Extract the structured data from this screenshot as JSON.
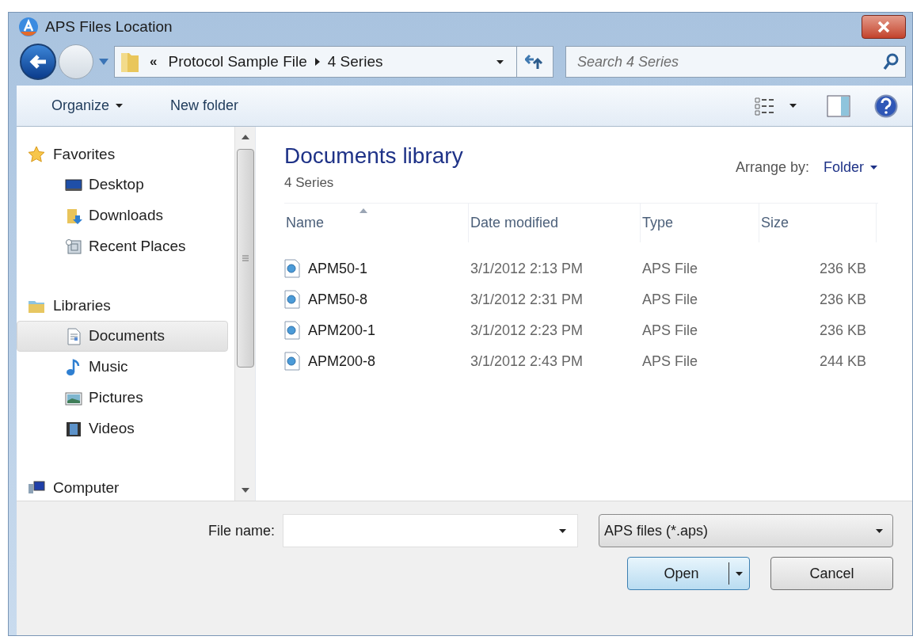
{
  "window": {
    "title": "APS Files Location"
  },
  "address": {
    "overflow": "«",
    "path": [
      "Protocol Sample File",
      "4 Series"
    ],
    "search_placeholder": "Search 4 Series"
  },
  "toolbar": {
    "organize": "Organize",
    "new_folder": "New folder"
  },
  "sidebar": {
    "groups": [
      {
        "label": "Favorites",
        "kind": "star",
        "selected": false,
        "children": [
          {
            "label": "Desktop",
            "kind": "desktop",
            "selected": false
          },
          {
            "label": "Downloads",
            "kind": "downloads",
            "selected": false
          },
          {
            "label": "Recent Places",
            "kind": "recent",
            "selected": false
          }
        ]
      },
      {
        "label": "Libraries",
        "kind": "library",
        "selected": false,
        "children": [
          {
            "label": "Documents",
            "kind": "document",
            "selected": true
          },
          {
            "label": "Music",
            "kind": "music",
            "selected": false
          },
          {
            "label": "Pictures",
            "kind": "pictures",
            "selected": false
          },
          {
            "label": "Videos",
            "kind": "videos",
            "selected": false
          }
        ]
      },
      {
        "label": "Computer",
        "kind": "computer",
        "selected": false
      }
    ]
  },
  "library": {
    "title": "Documents library",
    "subtitle": "4 Series",
    "arrange_label": "Arrange by:",
    "arrange_value": "Folder"
  },
  "table": {
    "columns": [
      "Name",
      "Date modified",
      "Type",
      "Size"
    ],
    "rows": [
      {
        "name": "APM50-1",
        "date": "3/1/2012 2:13 PM",
        "type": "APS File",
        "size": "236 KB"
      },
      {
        "name": "APM50-8",
        "date": "3/1/2012 2:31 PM",
        "type": "APS File",
        "size": "236 KB"
      },
      {
        "name": "APM200-1",
        "date": "3/1/2012 2:23 PM",
        "type": "APS File",
        "size": "236 KB"
      },
      {
        "name": "APM200-8",
        "date": "3/1/2012 2:43 PM",
        "type": "APS File",
        "size": "244 KB"
      }
    ]
  },
  "footer": {
    "file_name_label": "File name:",
    "file_type": "APS files (*.aps)",
    "open": "Open",
    "cancel": "Cancel"
  }
}
